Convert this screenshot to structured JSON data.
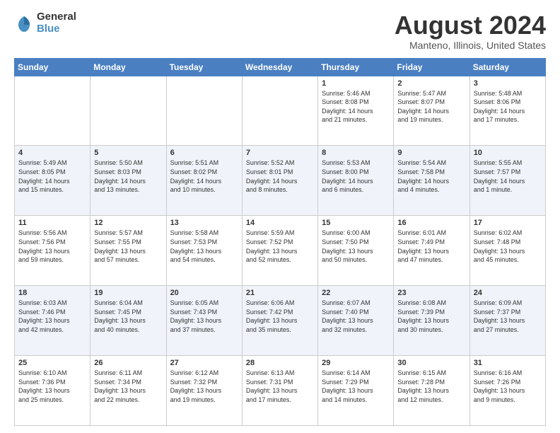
{
  "logo": {
    "general": "General",
    "blue": "Blue"
  },
  "header": {
    "title": "August 2024",
    "subtitle": "Manteno, Illinois, United States"
  },
  "days_of_week": [
    "Sunday",
    "Monday",
    "Tuesday",
    "Wednesday",
    "Thursday",
    "Friday",
    "Saturday"
  ],
  "weeks": [
    [
      {
        "day": "",
        "info": ""
      },
      {
        "day": "",
        "info": ""
      },
      {
        "day": "",
        "info": ""
      },
      {
        "day": "",
        "info": ""
      },
      {
        "day": "1",
        "info": "Sunrise: 5:46 AM\nSunset: 8:08 PM\nDaylight: 14 hours\nand 21 minutes."
      },
      {
        "day": "2",
        "info": "Sunrise: 5:47 AM\nSunset: 8:07 PM\nDaylight: 14 hours\nand 19 minutes."
      },
      {
        "day": "3",
        "info": "Sunrise: 5:48 AM\nSunset: 8:06 PM\nDaylight: 14 hours\nand 17 minutes."
      }
    ],
    [
      {
        "day": "4",
        "info": "Sunrise: 5:49 AM\nSunset: 8:05 PM\nDaylight: 14 hours\nand 15 minutes."
      },
      {
        "day": "5",
        "info": "Sunrise: 5:50 AM\nSunset: 8:03 PM\nDaylight: 14 hours\nand 13 minutes."
      },
      {
        "day": "6",
        "info": "Sunrise: 5:51 AM\nSunset: 8:02 PM\nDaylight: 14 hours\nand 10 minutes."
      },
      {
        "day": "7",
        "info": "Sunrise: 5:52 AM\nSunset: 8:01 PM\nDaylight: 14 hours\nand 8 minutes."
      },
      {
        "day": "8",
        "info": "Sunrise: 5:53 AM\nSunset: 8:00 PM\nDaylight: 14 hours\nand 6 minutes."
      },
      {
        "day": "9",
        "info": "Sunrise: 5:54 AM\nSunset: 7:58 PM\nDaylight: 14 hours\nand 4 minutes."
      },
      {
        "day": "10",
        "info": "Sunrise: 5:55 AM\nSunset: 7:57 PM\nDaylight: 14 hours\nand 1 minute."
      }
    ],
    [
      {
        "day": "11",
        "info": "Sunrise: 5:56 AM\nSunset: 7:56 PM\nDaylight: 13 hours\nand 59 minutes."
      },
      {
        "day": "12",
        "info": "Sunrise: 5:57 AM\nSunset: 7:55 PM\nDaylight: 13 hours\nand 57 minutes."
      },
      {
        "day": "13",
        "info": "Sunrise: 5:58 AM\nSunset: 7:53 PM\nDaylight: 13 hours\nand 54 minutes."
      },
      {
        "day": "14",
        "info": "Sunrise: 5:59 AM\nSunset: 7:52 PM\nDaylight: 13 hours\nand 52 minutes."
      },
      {
        "day": "15",
        "info": "Sunrise: 6:00 AM\nSunset: 7:50 PM\nDaylight: 13 hours\nand 50 minutes."
      },
      {
        "day": "16",
        "info": "Sunrise: 6:01 AM\nSunset: 7:49 PM\nDaylight: 13 hours\nand 47 minutes."
      },
      {
        "day": "17",
        "info": "Sunrise: 6:02 AM\nSunset: 7:48 PM\nDaylight: 13 hours\nand 45 minutes."
      }
    ],
    [
      {
        "day": "18",
        "info": "Sunrise: 6:03 AM\nSunset: 7:46 PM\nDaylight: 13 hours\nand 42 minutes."
      },
      {
        "day": "19",
        "info": "Sunrise: 6:04 AM\nSunset: 7:45 PM\nDaylight: 13 hours\nand 40 minutes."
      },
      {
        "day": "20",
        "info": "Sunrise: 6:05 AM\nSunset: 7:43 PM\nDaylight: 13 hours\nand 37 minutes."
      },
      {
        "day": "21",
        "info": "Sunrise: 6:06 AM\nSunset: 7:42 PM\nDaylight: 13 hours\nand 35 minutes."
      },
      {
        "day": "22",
        "info": "Sunrise: 6:07 AM\nSunset: 7:40 PM\nDaylight: 13 hours\nand 32 minutes."
      },
      {
        "day": "23",
        "info": "Sunrise: 6:08 AM\nSunset: 7:39 PM\nDaylight: 13 hours\nand 30 minutes."
      },
      {
        "day": "24",
        "info": "Sunrise: 6:09 AM\nSunset: 7:37 PM\nDaylight: 13 hours\nand 27 minutes."
      }
    ],
    [
      {
        "day": "25",
        "info": "Sunrise: 6:10 AM\nSunset: 7:36 PM\nDaylight: 13 hours\nand 25 minutes."
      },
      {
        "day": "26",
        "info": "Sunrise: 6:11 AM\nSunset: 7:34 PM\nDaylight: 13 hours\nand 22 minutes."
      },
      {
        "day": "27",
        "info": "Sunrise: 6:12 AM\nSunset: 7:32 PM\nDaylight: 13 hours\nand 19 minutes."
      },
      {
        "day": "28",
        "info": "Sunrise: 6:13 AM\nSunset: 7:31 PM\nDaylight: 13 hours\nand 17 minutes."
      },
      {
        "day": "29",
        "info": "Sunrise: 6:14 AM\nSunset: 7:29 PM\nDaylight: 13 hours\nand 14 minutes."
      },
      {
        "day": "30",
        "info": "Sunrise: 6:15 AM\nSunset: 7:28 PM\nDaylight: 13 hours\nand 12 minutes."
      },
      {
        "day": "31",
        "info": "Sunrise: 6:16 AM\nSunset: 7:26 PM\nDaylight: 13 hours\nand 9 minutes."
      }
    ]
  ]
}
